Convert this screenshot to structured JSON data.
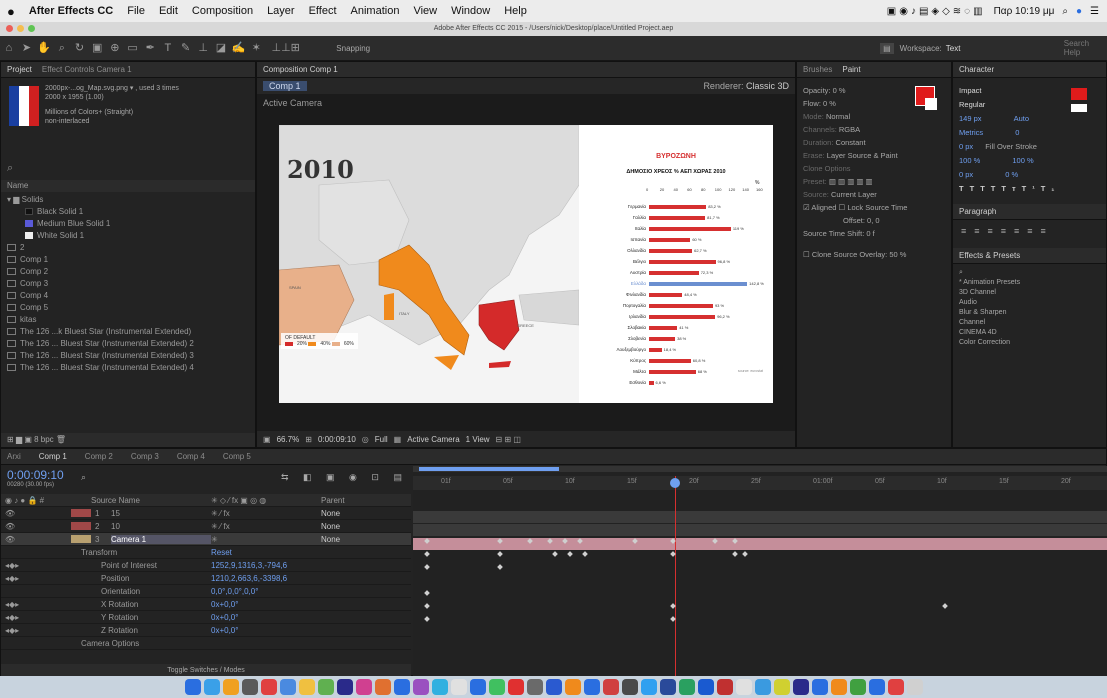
{
  "menubar": {
    "app": "After Effects CC",
    "items": [
      "File",
      "Edit",
      "Composition",
      "Layer",
      "Effect",
      "Animation",
      "View",
      "Window",
      "Help"
    ],
    "clock": "Παρ 10:19 μμ"
  },
  "titlebar": "Adobe After Effects CC 2015 - /Users/nick/Desktop/place/Untitled Project.aep",
  "toolbar": {
    "snapping": "Snapping",
    "workspace_label": "Workspace:",
    "workspace_value": "Text",
    "search_placeholder": "Search Help"
  },
  "project": {
    "tab": "Project",
    "tab2": "Effect Controls Camera 1",
    "info1": "2000px-...og_Map.svg.png ▾ , used 3 times",
    "info2": "2000 x 1955 (1.00)",
    "info3": "Millions of Colors+ (Straight)",
    "info4": "non-interlaced",
    "col_name": "Name",
    "items": [
      {
        "n": "Solids",
        "c": "#888"
      },
      {
        "n": "Black Solid 1",
        "c": "#111"
      },
      {
        "n": "Medium Blue Solid 1",
        "c": "#5a5ad8"
      },
      {
        "n": "White Solid 1",
        "c": "#eee"
      },
      {
        "n": "2",
        "c": ""
      },
      {
        "n": "Comp 1",
        "c": ""
      },
      {
        "n": "Comp 2",
        "c": ""
      },
      {
        "n": "Comp 3",
        "c": ""
      },
      {
        "n": "Comp 4",
        "c": ""
      },
      {
        "n": "Comp 5",
        "c": ""
      },
      {
        "n": "kitas",
        "c": ""
      },
      {
        "n": "The 126 ...k Bluest Star (Instrumental Extended)",
        "c": ""
      },
      {
        "n": "The 126 ... Bluest Star (Instrumental Extended) 2",
        "c": ""
      },
      {
        "n": "The 126 ... Bluest Star (Instrumental Extended) 3",
        "c": ""
      },
      {
        "n": "The 126 ... Bluest Star (Instrumental Extended) 4",
        "c": ""
      }
    ],
    "bpc": "8 bpc"
  },
  "comp": {
    "tab": "Composition Comp 1",
    "sub": "Comp 1",
    "renderer_label": "Renderer:",
    "renderer": "Classic 3D",
    "view_label": "Active Camera",
    "zoom": "66.7%",
    "timecode": "0:00:09:10",
    "quality": "Full",
    "camera": "Active Camera",
    "views": "1 View"
  },
  "map": {
    "year": "2010",
    "legend_title": "OF DEFAULT",
    "legend_items": [
      "20%",
      "40%",
      "60%"
    ],
    "label_italy": "ITALY",
    "label_greece": "GREECE",
    "label_spain": "SPAIN",
    "source": "source: eurostat"
  },
  "chart_data": {
    "type": "bar",
    "title": "ΒΥΡΟΖΩΝΗ",
    "subtitle": "ΔΗΜΟΣΙΟ ΧΡΕΟΣ % ΑΕΠ ΧΩΡΑΣ 2010",
    "xlabel": "%",
    "xticks": [
      0,
      20,
      40,
      60,
      80,
      100,
      120,
      140,
      160
    ],
    "xlim": [
      0,
      160
    ],
    "categories": [
      "Γερμανία",
      "Γαλλία",
      "Ιταλία",
      "Ισπανία",
      "Ολλανδία",
      "Βέλγιο",
      "Αυστρία",
      "Ελλάδα",
      "Φινλανδία",
      "Πορτογαλία",
      "Ιρλανδία",
      "Σλοβακία",
      "Σλοβενία",
      "Λουξεμβούργο",
      "Κύπρος",
      "Μάλτα",
      "Εσθονία"
    ],
    "values": [
      83.2,
      81.7,
      119.0,
      60.1,
      62.7,
      96.8,
      72.3,
      142.8,
      48.4,
      93.0,
      96.2,
      41.0,
      38.0,
      18.4,
      60.8,
      68.0,
      6.6
    ],
    "value_labels": [
      "83,2 %",
      "81,7 %",
      "119 %",
      "60 %",
      "62,7 %",
      "96,8 %",
      "72,3 %",
      "142,8 %",
      "48,4 %",
      "93 %",
      "96,2 %",
      "41 %",
      "38 %",
      "18,4 %",
      "60,8 %",
      "68 %",
      "6,6 %"
    ],
    "highlight": "Ελλάδα",
    "colors": {
      "bar": "#d63030",
      "highlight": "#6b8fd0"
    }
  },
  "paint": {
    "tabs": [
      "Brushes",
      "Paint"
    ],
    "opacity": "Opacity: 0 %",
    "flow": "Flow: 0 %",
    "mode_label": "Mode:",
    "mode": "Normal",
    "channels_label": "Channels:",
    "channels": "RGBA",
    "duration_label": "Duration:",
    "duration": "Constant",
    "erase_label": "Erase:",
    "erase": "Layer Source & Paint",
    "clone_label": "Clone Options",
    "preset_label": "Preset:",
    "source_label": "Source:",
    "source": "Current Layer",
    "aligned": "Aligned",
    "lock": "Lock Source Time",
    "offset": "Offset: 0, 0",
    "src_time": "Source Time Shift: 0 f",
    "clone_overlay": "Clone Source Overlay: 50 %"
  },
  "character": {
    "tab": "Character",
    "font": "Impact",
    "style": "Regular",
    "size": "149 px",
    "leading": "Auto",
    "tracking": "Metrics",
    "kerning": "0",
    "stroke_w": "0 px",
    "stroke": "Fill Over Stroke",
    "vscale": "100 %",
    "hscale": "100 %",
    "baseline": "0 px",
    "tsume": "0 %",
    "styles": [
      "T",
      "T",
      "TT",
      "Tт",
      "T¹",
      "T₁"
    ],
    "paragraph_tab": "Paragraph",
    "effects_tab": "Effects & Presets",
    "effects": [
      "* Animation Presets",
      "3D Channel",
      "Audio",
      "Blur & Sharpen",
      "Channel",
      "CINEMA 4D",
      "Color Correction"
    ],
    "color": "#e01b1b"
  },
  "timeline": {
    "tabs": [
      "Arxi",
      "Comp 1",
      "Comp 2",
      "Comp 3",
      "Comp 4",
      "Comp 5"
    ],
    "timecode": "0:00:09:10",
    "fps": "00280 (30.00 fps)",
    "cols": [
      "Source Name",
      "Parent"
    ],
    "ruler": [
      "01f",
      "05f",
      "10f",
      "15f",
      "20f",
      "25f",
      "01:00f",
      "05f",
      "10f",
      "15f",
      "20f"
    ],
    "layers": [
      {
        "num": "1",
        "name": "15",
        "parent": "None"
      },
      {
        "num": "2",
        "name": "10",
        "parent": "None"
      },
      {
        "num": "3",
        "name": "Camera 1",
        "parent": "None"
      }
    ],
    "props": [
      {
        "name": "Transform",
        "value": "Reset"
      },
      {
        "name": "Point of Interest",
        "value": "1252,9,1316,3,-794,6"
      },
      {
        "name": "Position",
        "value": "1210,2,663,6,-3398,6"
      },
      {
        "name": "Orientation",
        "value": "0,0°,0,0°,0,0°"
      },
      {
        "name": "X Rotation",
        "value": "0x+0,0°"
      },
      {
        "name": "Y Rotation",
        "value": "0x+0,0°"
      },
      {
        "name": "Z Rotation",
        "value": "0x+0,0°"
      },
      {
        "name": "Camera Options",
        "value": ""
      }
    ],
    "toggle": "Toggle Switches / Modes"
  }
}
